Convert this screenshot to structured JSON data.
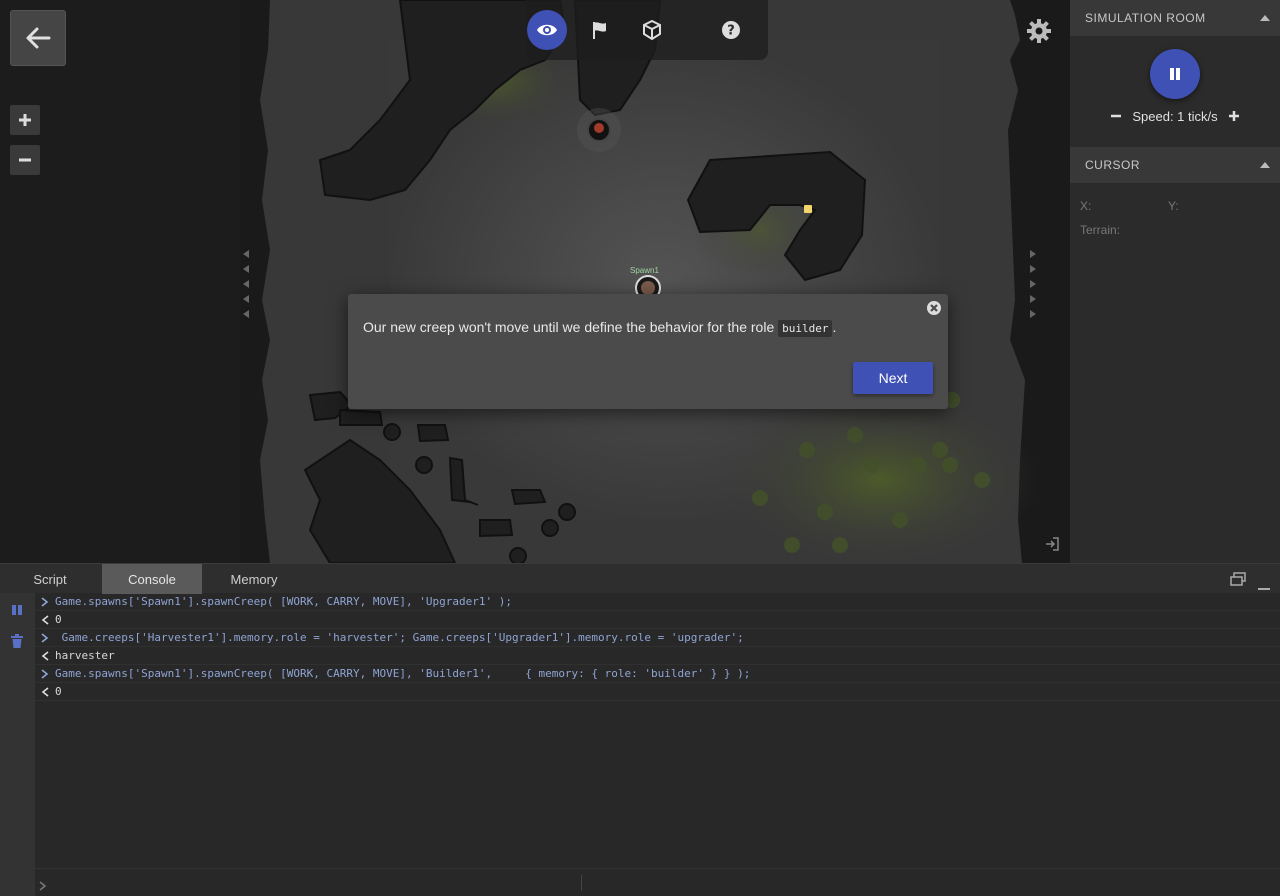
{
  "map": {
    "spawn_label": "Spawn1"
  },
  "dialog": {
    "text_before": "Our new creep won't move until we define the behavior for the role ",
    "code": "builder",
    "text_after": ".",
    "next_label": "Next"
  },
  "right_panel": {
    "simulation_title": "SIMULATION ROOM",
    "speed_text": "Speed: 1 tick/s",
    "cursor_title": "CURSOR",
    "x_label": "X:",
    "y_label": "Y:",
    "terrain_label": "Terrain:"
  },
  "console": {
    "tabs": [
      "Script",
      "Console",
      "Memory"
    ],
    "active_tab": "Console",
    "lines": [
      {
        "type": "cmd",
        "text": "Game.spawns['Spawn1'].spawnCreep( [WORK, CARRY, MOVE], 'Upgrader1' );"
      },
      {
        "type": "res",
        "text": "0"
      },
      {
        "type": "cmd",
        "text": " Game.creeps['Harvester1'].memory.role = 'harvester'; Game.creeps['Upgrader1'].memory.role = 'upgrader';"
      },
      {
        "type": "res",
        "text": "harvester"
      },
      {
        "type": "cmd",
        "text": "Game.spawns['Spawn1'].spawnCreep( [WORK, CARRY, MOVE], 'Builder1',     { memory: { role: 'builder' } } );"
      },
      {
        "type": "res",
        "text": "0"
      }
    ],
    "input_value": ""
  },
  "colors": {
    "accent": "#3f51b5",
    "command_text": "#8fa4d4"
  },
  "icons": {
    "toolbar": [
      "eye-icon",
      "flag-icon",
      "cube-icon",
      "help-icon"
    ],
    "settings": "gear-icon",
    "back": "arrow-left-icon"
  }
}
